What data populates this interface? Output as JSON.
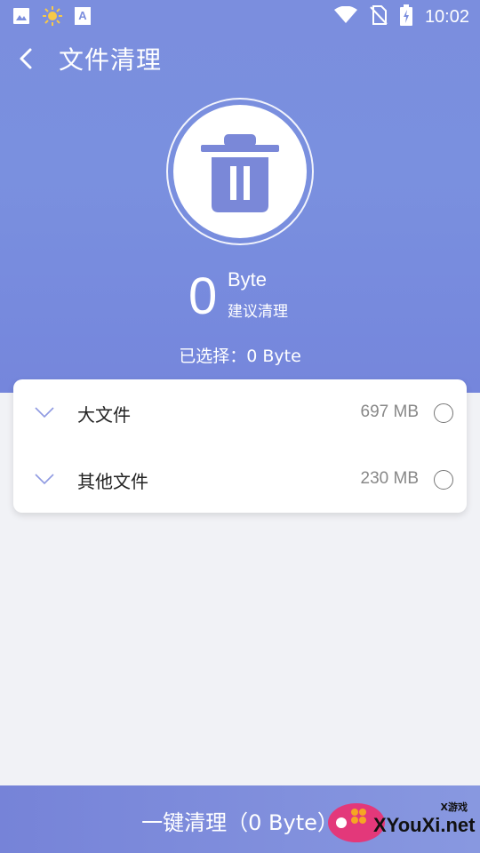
{
  "status_bar": {
    "time": "10:02",
    "icons_left": [
      "image-icon",
      "sun-icon",
      "font-icon"
    ],
    "icons_right": [
      "wifi-icon",
      "no-sim-icon",
      "battery-icon"
    ]
  },
  "app_bar": {
    "title": "文件清理",
    "back_icon": "chevron-left-icon"
  },
  "summary": {
    "size_value": "0",
    "size_unit": "Byte",
    "note": "建议清理",
    "selected": "已选择：0 Byte"
  },
  "categories": [
    {
      "label": "大文件",
      "size": "697 MB",
      "checked": false
    },
    {
      "label": "其他文件",
      "size": "230 MB",
      "checked": false
    }
  ],
  "bottom_button": {
    "label": "一键清理（0 Byte）"
  },
  "watermark": {
    "small": "X游戏",
    "big": "XYouXi.net"
  },
  "colors": {
    "primary": "#7b8ede",
    "background": "#f1f2f6",
    "trash": "#7a88d8"
  }
}
